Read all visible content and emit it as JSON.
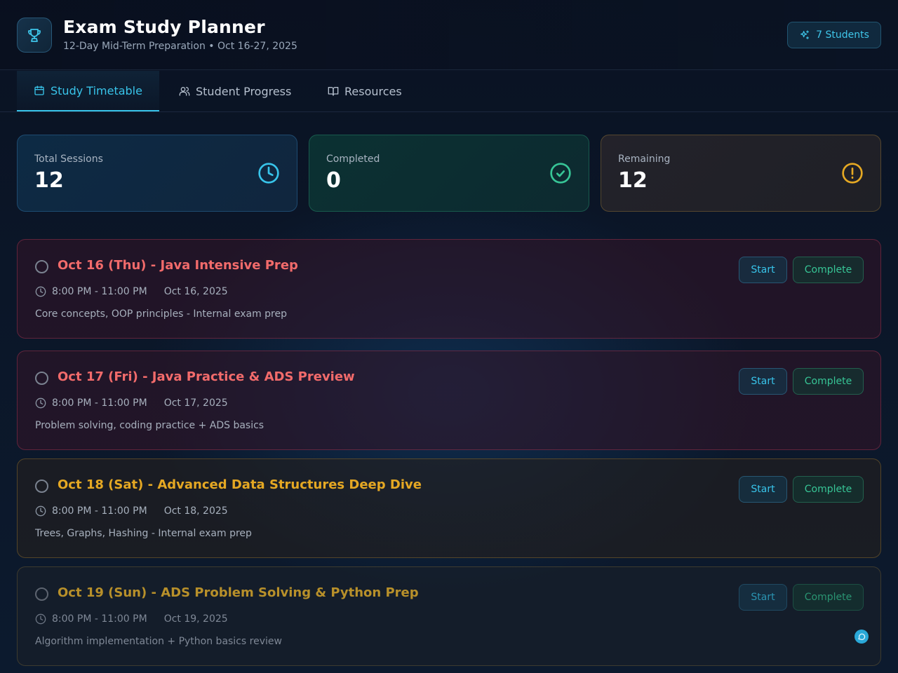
{
  "header": {
    "title": "Exam Study Planner",
    "subtitle": "12-Day Mid-Term Preparation • Oct 16-27, 2025",
    "students_badge": "7 Students"
  },
  "tabs": [
    {
      "label": "Study Timetable",
      "icon": "calendar-icon",
      "active": true
    },
    {
      "label": "Student Progress",
      "icon": "users-icon",
      "active": false
    },
    {
      "label": "Resources",
      "icon": "book-icon",
      "active": false
    }
  ],
  "stats": {
    "total": {
      "label": "Total Sessions",
      "value": "12",
      "icon": "clock-icon"
    },
    "completed": {
      "label": "Completed",
      "value": "0",
      "icon": "check-circle-icon"
    },
    "remaining": {
      "label": "Remaining",
      "value": "12",
      "icon": "alert-circle-icon"
    }
  },
  "sessions": [
    {
      "title": "Oct 16 (Thu) - Java Intensive Prep",
      "time": "8:00 PM - 11:00 PM",
      "date": "Oct 16, 2025",
      "description": "Core concepts, OOP principles - Internal exam prep",
      "start_label": "Start",
      "complete_label": "Complete"
    },
    {
      "title": "Oct 17 (Fri) - Java Practice & ADS Preview",
      "time": "8:00 PM - 11:00 PM",
      "date": "Oct 17, 2025",
      "description": "Problem solving, coding practice + ADS basics",
      "start_label": "Start",
      "complete_label": "Complete"
    },
    {
      "title": "Oct 18 (Sat) - Advanced Data Structures Deep Dive",
      "time": "8:00 PM - 11:00 PM",
      "date": "Oct 18, 2025",
      "description": "Trees, Graphs, Hashing - Internal exam prep",
      "start_label": "Start",
      "complete_label": "Complete"
    },
    {
      "title": "Oct 19 (Sun) - ADS Problem Solving & Python Prep",
      "time": "8:00 PM - 11:00 PM",
      "date": "Oct 19, 2025",
      "description": "Algorithm implementation + Python basics review",
      "start_label": "Start",
      "complete_label": "Complete"
    }
  ],
  "colors": {
    "accent": "#38c4ea",
    "success": "#37c596",
    "warning": "#e5a823",
    "danger": "#f26b6b"
  }
}
